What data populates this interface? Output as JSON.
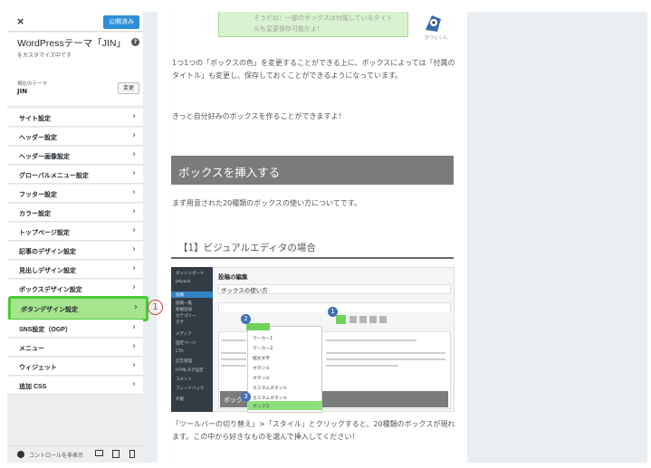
{
  "sidebar": {
    "close_glyph": "×",
    "publish_label": "公開済み",
    "title": "WordPressテーマ「JIN」の",
    "subtitle": "をカスタマイズ中です",
    "theme_label": "現在のテーマ",
    "theme_name": "JIN",
    "change_label": "変更",
    "items": [
      {
        "label": "サイト設定"
      },
      {
        "label": "ヘッダー設定"
      },
      {
        "label": "ヘッダー画像設定"
      },
      {
        "label": "グローバルメニュー設定"
      },
      {
        "label": "フッター設定"
      },
      {
        "label": "カラー設定"
      },
      {
        "label": "トップページ設定"
      },
      {
        "label": "記事のデザイン設定"
      },
      {
        "label": "見出しデザイン設定"
      },
      {
        "label": "ボックスデザイン設定"
      },
      {
        "label": "ボタンデザイン設定"
      },
      {
        "label": "SNS設定（OGP）"
      },
      {
        "label": "メニュー"
      },
      {
        "label": "ウィジェット"
      },
      {
        "label": "追加 CSS"
      }
    ],
    "highlight_marker": "1",
    "footer_label": "コントロールを非表示"
  },
  "icons": {
    "chevron": "›",
    "help": "?",
    "help_icon": "question-icon"
  },
  "article": {
    "note_text": "そうだね！一部のボックスは付属しているタイトルも変更保存可能だよ！",
    "note_name": "ひつじくん",
    "para1": "1つ1つの「ボックスの色」を変更することができる上に、ボックスによっては「付属のタイトル」も変更し、保存しておくことができるようになっています。",
    "para2": "きっと自分好みのボックスを作ることができますよ！",
    "h2": "ボックスを挿入する",
    "para3": "まず用意された20種類のボックスの使い方についてです。",
    "h3": "【1】ビジュアルエディタの場合",
    "para4": "「ツールバーの切り替え」>「スタイル」とクリックすると、20種類のボックスが現れます。この中から好きなものを選んで挿入してください！",
    "editor": {
      "title1": "投稿の編集",
      "title2": "ボックスの使い方",
      "side_items": [
        "ダッシュボード",
        "Jetpack",
        "投稿",
        "投稿一覧",
        "新規追加",
        "カテゴリー",
        "タグ",
        "メディア",
        "固定ページ",
        "CTA",
        "広告管理",
        "HTMLタグ設定",
        "コメント",
        "フィードバック",
        "外観"
      ],
      "dropdown_items": [
        "マーカー1",
        "マーカー2",
        "極太文字",
        "ボタン①",
        "ボタン②",
        "カスタムボタン①",
        "カスタムボタン②",
        "ボックス"
      ],
      "badges": [
        "1",
        "2",
        "3"
      ],
      "heading_text": "ボックス"
    }
  },
  "colors": {
    "highlight_bg": "#a6e48e",
    "highlight_border": "#4ccb36",
    "marker": "#d14040",
    "heading_bg": "#7b7b7b",
    "preview_bg": "#e9eef2"
  }
}
